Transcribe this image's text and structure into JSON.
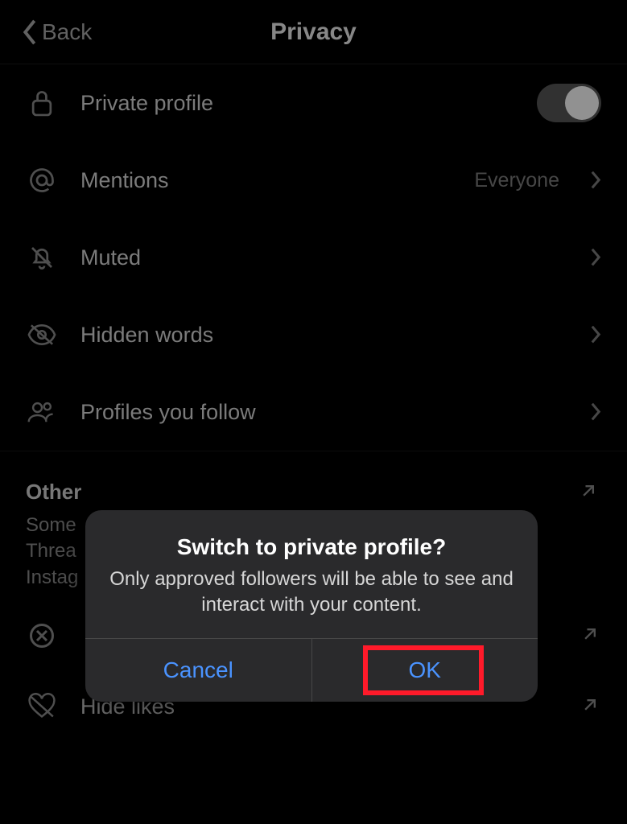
{
  "header": {
    "back_label": "Back",
    "title": "Privacy"
  },
  "settings": {
    "private_profile": {
      "label": "Private profile",
      "enabled": true
    },
    "mentions": {
      "label": "Mentions",
      "value": "Everyone"
    },
    "muted": {
      "label": "Muted"
    },
    "hidden_words": {
      "label": "Hidden words"
    },
    "profiles_follow": {
      "label": "Profiles you follow"
    }
  },
  "other_section": {
    "title": "Other",
    "desc_line1": "Some",
    "desc_line2": "Threa",
    "desc_line3": "Instag",
    "blocked_label_partial": "",
    "hide_likes": {
      "label": "Hide likes"
    }
  },
  "alert": {
    "title": "Switch to private profile?",
    "message": "Only approved followers will be able to see and interact with your content.",
    "cancel": "Cancel",
    "ok": "OK"
  }
}
